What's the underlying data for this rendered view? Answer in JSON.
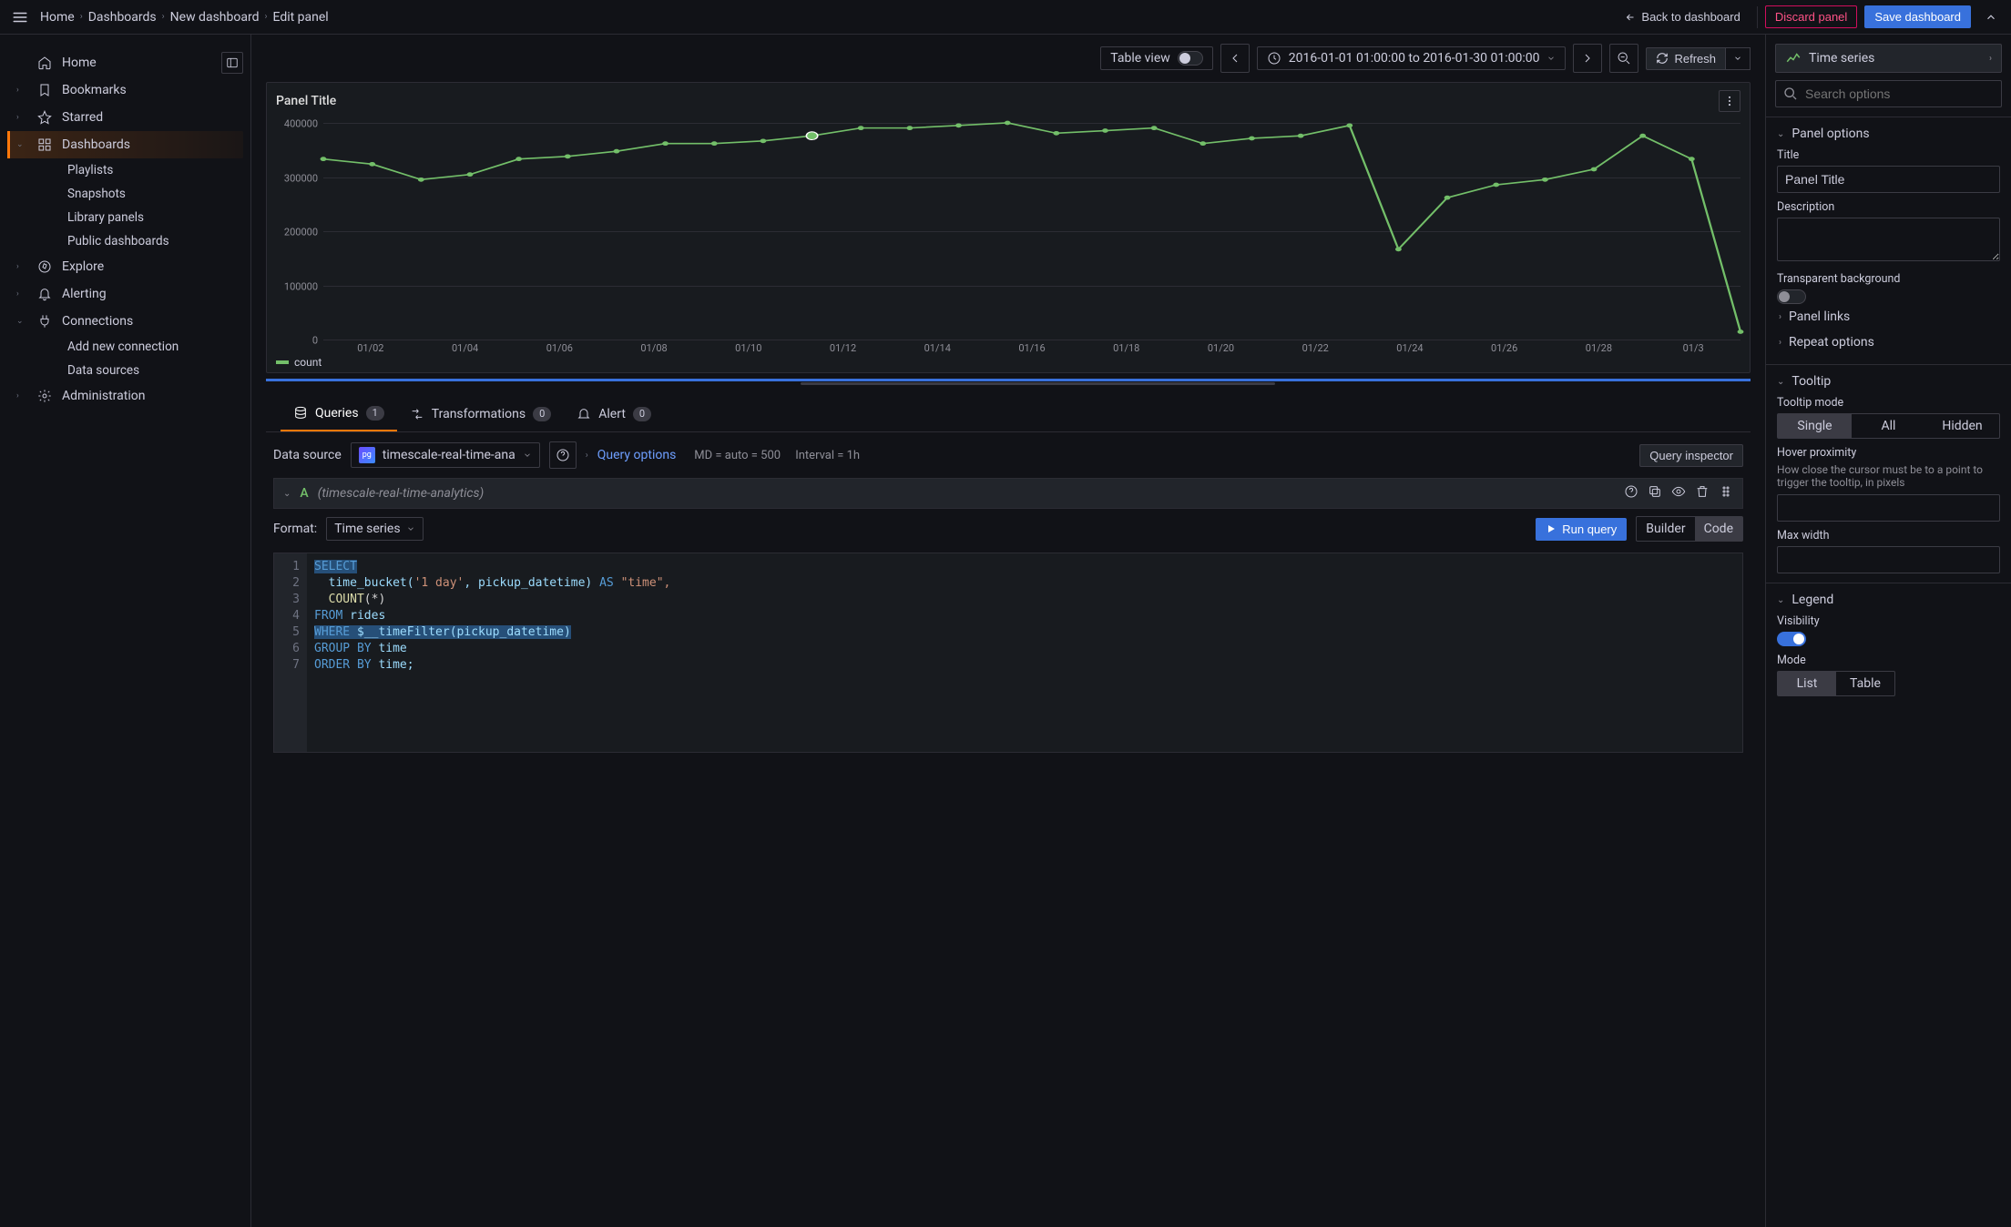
{
  "breadcrumb": [
    "Home",
    "Dashboards",
    "New dashboard",
    "Edit panel"
  ],
  "topbar": {
    "back": "Back to dashboard",
    "discard": "Discard panel",
    "save": "Save dashboard"
  },
  "sidebar": {
    "items": [
      {
        "label": "Home",
        "icon": "home",
        "expandable": false
      },
      {
        "label": "Bookmarks",
        "icon": "bookmark",
        "expandable": true
      },
      {
        "label": "Starred",
        "icon": "star",
        "expandable": true
      },
      {
        "label": "Dashboards",
        "icon": "apps",
        "expandable": true,
        "active": true,
        "children": [
          "Playlists",
          "Snapshots",
          "Library panels",
          "Public dashboards"
        ]
      },
      {
        "label": "Explore",
        "icon": "compass",
        "expandable": true
      },
      {
        "label": "Alerting",
        "icon": "bell",
        "expandable": true
      },
      {
        "label": "Connections",
        "icon": "plug",
        "expandable": true,
        "children": [
          "Add new connection",
          "Data sources"
        ]
      },
      {
        "label": "Administration",
        "icon": "gear",
        "expandable": true
      }
    ]
  },
  "toolbar": {
    "table_view": "Table view",
    "time_range": "2016-01-01 01:00:00 to 2016-01-30 01:00:00",
    "refresh": "Refresh"
  },
  "panel": {
    "title": "Panel Title",
    "legend": "count"
  },
  "chart_data": {
    "type": "line",
    "title": "Panel Title",
    "x": [
      "01/02",
      "01/04",
      "01/06",
      "01/08",
      "01/10",
      "01/12",
      "01/14",
      "01/16",
      "01/18",
      "01/20",
      "01/22",
      "01/24",
      "01/26",
      "01/28",
      "01/30"
    ],
    "xticks": [
      "01/02",
      "01/04",
      "01/06",
      "01/08",
      "01/10",
      "01/12",
      "01/14",
      "01/16",
      "01/18",
      "01/20",
      "01/22",
      "01/24",
      "01/26",
      "01/28",
      "01/3"
    ],
    "yticks": [
      0,
      100000,
      200000,
      300000,
      400000
    ],
    "ylim": [
      0,
      420000
    ],
    "series": [
      {
        "name": "count",
        "values": [
          350000,
          340000,
          310000,
          320000,
          350000,
          355000,
          365000,
          380000,
          380000,
          385000,
          395000,
          410000,
          410000,
          415000,
          420000,
          400000,
          405000,
          410000,
          380000,
          390000,
          395000,
          415000,
          175000,
          275000,
          300000,
          310000,
          330000,
          395000,
          350000,
          15000
        ]
      }
    ]
  },
  "tabs": {
    "queries": {
      "label": "Queries",
      "count": "1"
    },
    "transformations": {
      "label": "Transformations",
      "count": "0"
    },
    "alert": {
      "label": "Alert",
      "count": "0"
    }
  },
  "query": {
    "ds_label": "Data source",
    "ds_name": "timescale-real-time-ana",
    "options_label": "Query options",
    "md_label": "MD",
    "auto": "auto",
    "md_value": "500",
    "interval_label": "Interval",
    "interval_value": "1h",
    "inspector": "Query inspector",
    "row": {
      "id": "A",
      "name": "(timescale-real-time-analytics)"
    },
    "format_label": "Format:",
    "format_value": "Time series",
    "run": "Run query",
    "builder": "Builder",
    "code": "Code",
    "sql": {
      "l1": "SELECT",
      "l2a": "  time_bucket(",
      "l2b": "'1 day'",
      "l2c": ", pickup_datetime) ",
      "l2d": "AS",
      "l2e": " \"time\",",
      "l3a": "  COUNT",
      "l3b": "(*)",
      "l4a": "FROM",
      "l4b": " rides",
      "l5a": "WHERE",
      "l5b": " $__timeFilter(pickup_datetime)",
      "l6a": "GROUP",
      "l6b": " BY",
      "l6c": " time",
      "l7a": "ORDER",
      "l7b": " BY",
      "l7c": " time;"
    },
    "gutter": [
      "1",
      "2",
      "3",
      "4",
      "5",
      "6",
      "7"
    ]
  },
  "right": {
    "viz": "Time series",
    "search_placeholder": "Search options",
    "panel_options": "Panel options",
    "title_label": "Title",
    "title_value": "Panel Title",
    "description_label": "Description",
    "transparent_label": "Transparent background",
    "panel_links": "Panel links",
    "repeat": "Repeat options",
    "tooltip": "Tooltip",
    "tooltip_mode_label": "Tooltip mode",
    "tooltip_mode": {
      "single": "Single",
      "all": "All",
      "hidden": "Hidden"
    },
    "hover_label": "Hover proximity",
    "hover_desc": "How close the cursor must be to a point to trigger the tooltip, in pixels",
    "maxw": "Max width",
    "legend": "Legend",
    "visibility": "Visibility",
    "mode_label": "Mode",
    "mode": {
      "list": "List",
      "table": "Table"
    }
  }
}
